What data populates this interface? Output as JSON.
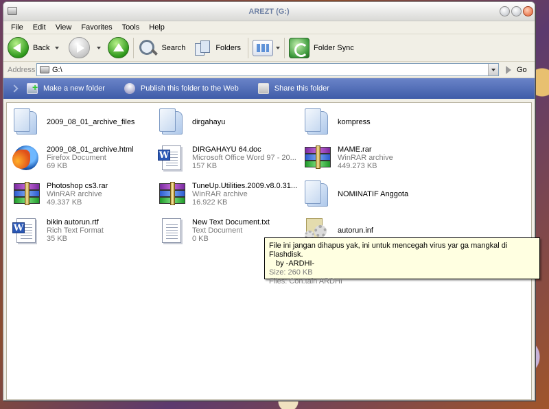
{
  "window": {
    "title": "AREZT (G:)"
  },
  "menu": [
    "File",
    "Edit",
    "View",
    "Favorites",
    "Tools",
    "Help"
  ],
  "toolbar": {
    "back_label": "Back",
    "search_label": "Search",
    "folders_label": "Folders",
    "folder_sync_label": "Folder Sync"
  },
  "address": {
    "label": "Address",
    "value": "G:\\",
    "go_label": "Go"
  },
  "tasks": {
    "new_folder": "Make a new folder",
    "publish": "Publish this folder to the Web",
    "share": "Share this folder"
  },
  "items": [
    {
      "name": "2009_08_01_archive_files",
      "type": "",
      "size": "",
      "icon": "folder-icon"
    },
    {
      "name": "dirgahayu",
      "type": "",
      "size": "",
      "icon": "folder-icon"
    },
    {
      "name": "kompress",
      "type": "",
      "size": "",
      "icon": "folder-icon"
    },
    {
      "name": "2009_08_01_archive.html",
      "type": "Firefox Document",
      "size": "69 KB",
      "icon": "firefox-icon"
    },
    {
      "name": "DIRGAHAYU 64.doc",
      "type": "Microsoft Office Word 97 - 20...",
      "size": "157 KB",
      "icon": "word-document-icon"
    },
    {
      "name": "MAME.rar",
      "type": "WinRAR archive",
      "size": "449.273 KB",
      "icon": "winrar-icon"
    },
    {
      "name": "Photoshop cs3.rar",
      "type": "WinRAR archive",
      "size": "49.337 KB",
      "icon": "winrar-icon"
    },
    {
      "name": "TuneUp.Utilities.2009.v8.0.31...",
      "type": "WinRAR archive",
      "size": "16.922 KB",
      "icon": "winrar-icon"
    },
    {
      "name": "NOMINATIF Anggota",
      "type": "",
      "size": "",
      "icon": "folder-icon"
    },
    {
      "name": "bikin autorun.rtf",
      "type": "Rich Text Format",
      "size": "35 KB",
      "icon": "word-document-icon"
    },
    {
      "name": "New Text Document.txt",
      "type": "Text Document",
      "size": "0 KB",
      "icon": "text-document-icon"
    },
    {
      "name": "autorun.inf",
      "type": "",
      "size": "",
      "icon": "settings-file-icon"
    }
  ],
  "tooltip": {
    "line1": "File ini jangan dihapus yak, ini untuk mencegah virus yar ga mangkal di Flashdisk.",
    "line2": "by -ARDHI-",
    "line3": "Size: 260 KB",
    "line4": "Files: Con.tain ARDHI"
  },
  "colors": {
    "taskbar": "#4a67b4",
    "tooltip_bg": "#ffffe1",
    "title_text": "#6d7fa3"
  }
}
